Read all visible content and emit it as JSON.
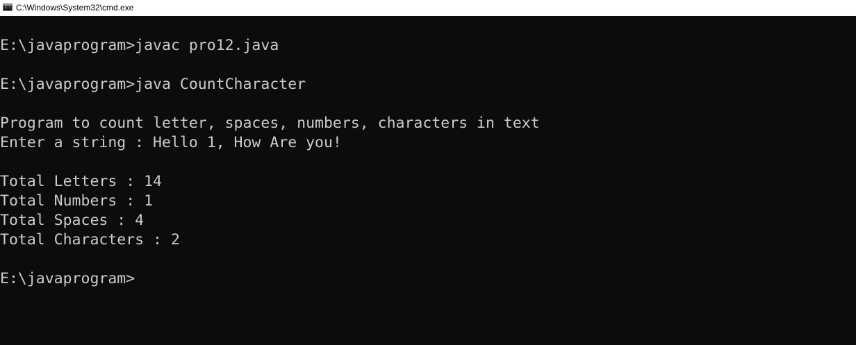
{
  "window": {
    "title": "C:\\Windows\\System32\\cmd.exe",
    "icon": "cmd-icon"
  },
  "console": {
    "lines": [
      "E:\\javaprogram>javac pro12.java",
      "",
      "E:\\javaprogram>java CountCharacter",
      "",
      "Program to count letter, spaces, numbers, characters in text",
      "Enter a string : Hello 1, How Are you!",
      "",
      "Total Letters : 14",
      "Total Numbers : 1",
      "Total Spaces : 4",
      "Total Characters : 2",
      "",
      "E:\\javaprogram>"
    ]
  },
  "colors": {
    "background": "#0c0c0c",
    "foreground": "#cccccc",
    "titlebar": "#ffffff"
  }
}
